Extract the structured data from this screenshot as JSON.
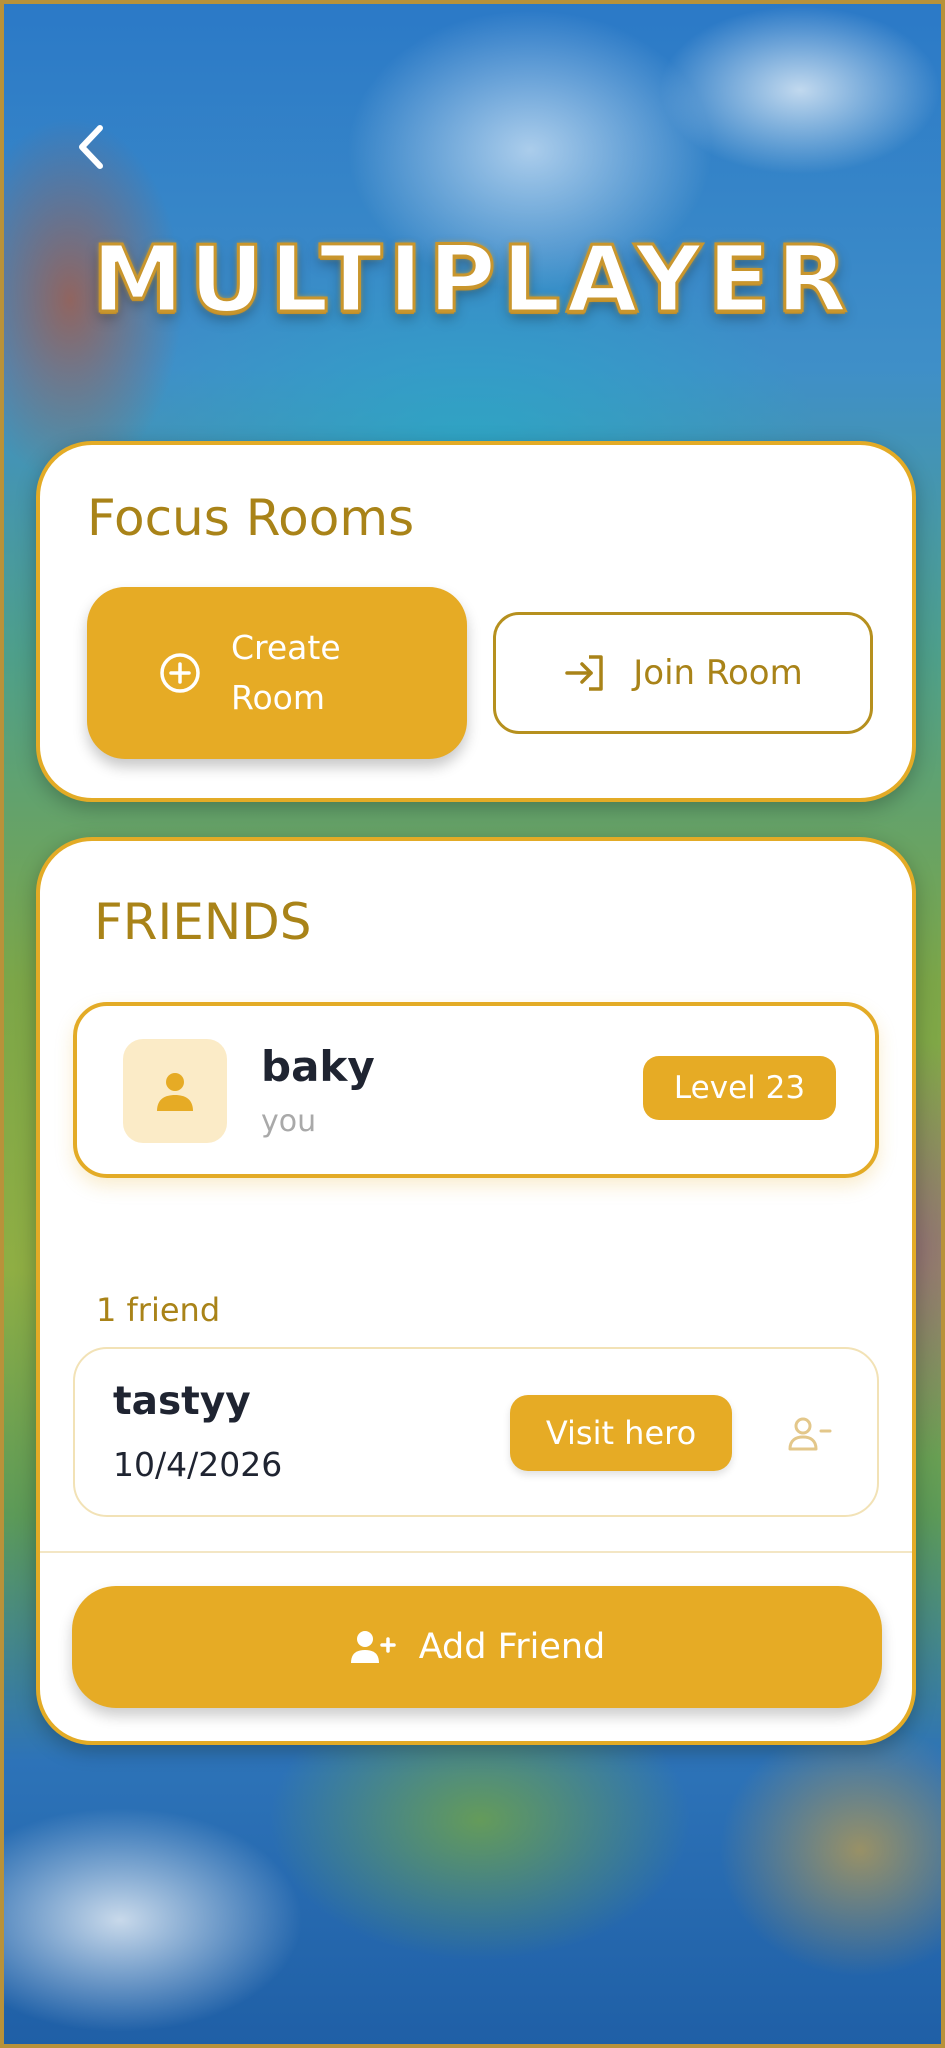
{
  "header": {
    "back_icon": "chevron-left-icon",
    "title": "MULTIPLAYER"
  },
  "focus_rooms": {
    "title": "Focus Rooms",
    "create_button": {
      "label": "Create\nRoom",
      "icon": "plus-circle-icon"
    },
    "join_button": {
      "label": "Join Room",
      "icon": "login-arrow-icon"
    }
  },
  "friends": {
    "title": "FRIENDS",
    "me": {
      "name": "baky",
      "subtitle": "you",
      "level": "Level 23",
      "icon": "user-icon"
    },
    "count_label": "1 friend",
    "list": [
      {
        "name": "tastyy",
        "date": "10/4/2026",
        "visit_label": "Visit hero",
        "remove_icon": "user-minus-icon"
      }
    ],
    "add_button": {
      "label": "Add Friend",
      "icon": "user-plus-icon"
    }
  },
  "colors": {
    "accent": "#e6ab25",
    "accent_dark": "#a98318",
    "text_dark": "#1f2431",
    "text_muted": "#a9a9a9",
    "avatar_bg": "#fbebc7"
  }
}
